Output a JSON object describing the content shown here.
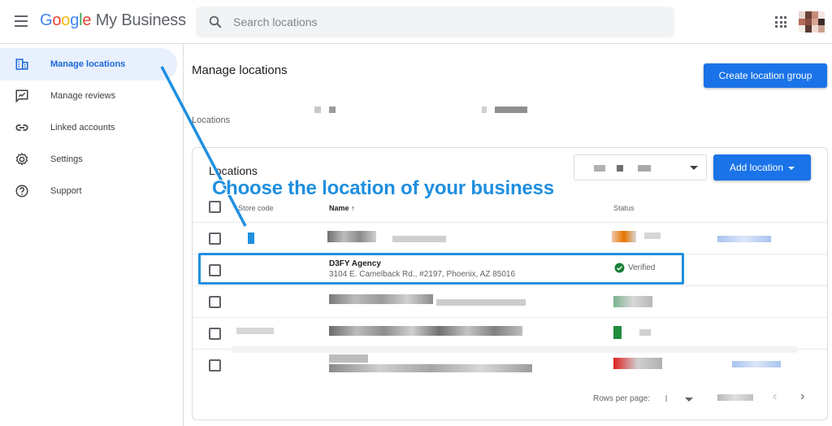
{
  "header": {
    "logo_google": "Google",
    "logo_product": "My Business",
    "search_placeholder": "Search locations"
  },
  "sidebar": {
    "items": [
      {
        "label": "Manage locations",
        "icon": "building-icon",
        "active": true
      },
      {
        "label": "Manage reviews",
        "icon": "reviews-icon",
        "active": false
      },
      {
        "label": "Linked accounts",
        "icon": "link-icon",
        "active": false
      },
      {
        "label": "Settings",
        "icon": "gear-icon",
        "active": false
      },
      {
        "label": "Support",
        "icon": "help-icon",
        "active": false
      }
    ]
  },
  "main": {
    "title": "Manage locations",
    "create_group_label": "Create location group",
    "locations_label": "Locations"
  },
  "table": {
    "title": "Locations",
    "add_label": "Add location",
    "columns": {
      "store_code": "Store code",
      "name": "Name",
      "status": "Status"
    },
    "highlighted_row": {
      "name": "D3FY Agency",
      "address": "3104 E. Camelback Rd., #2197, Phoenix, AZ 85016",
      "status": "Verified"
    },
    "rows_per_page_label": "Rows per page:"
  },
  "annotation": {
    "callout": "Choose the location of your business"
  },
  "colors": {
    "accent": "#1a73e8",
    "callout": "#1f8fe0",
    "verified": "#188038"
  }
}
